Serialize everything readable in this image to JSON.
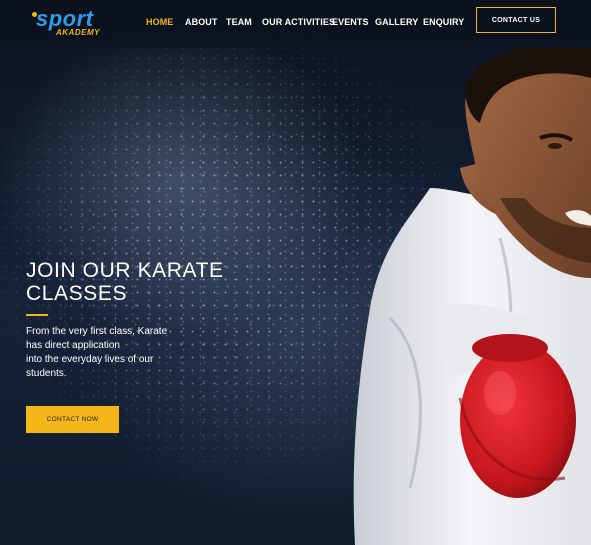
{
  "brand": {
    "logo_main": "sport",
    "logo_sub": "AKADEMY"
  },
  "nav": {
    "items": [
      {
        "label": "HOME",
        "active": true
      },
      {
        "label": "ABOUT",
        "active": false
      },
      {
        "label": "TEAM",
        "active": false
      },
      {
        "label": "OUR ACTIVITIES",
        "active": false
      },
      {
        "label": "EVENTS",
        "active": false
      },
      {
        "label": "GALLERY",
        "active": false
      },
      {
        "label": "ENQUIRY",
        "active": false
      }
    ],
    "contact_label": "CONTACT US"
  },
  "hero": {
    "title_line1": "JOIN OUR KARATE",
    "title_line2": "CLASSES",
    "desc_line1": "From the very first class, Karate",
    "desc_line2": "has direct application",
    "desc_line3": "into the everyday lives of our",
    "desc_line4": "students.",
    "cta_label": "CONTACT NOW"
  },
  "colors": {
    "accent": "#f0b71a",
    "logo_blue": "#2f9be8",
    "header_bg": "#0c121e",
    "glove_red": "#d81f26"
  }
}
